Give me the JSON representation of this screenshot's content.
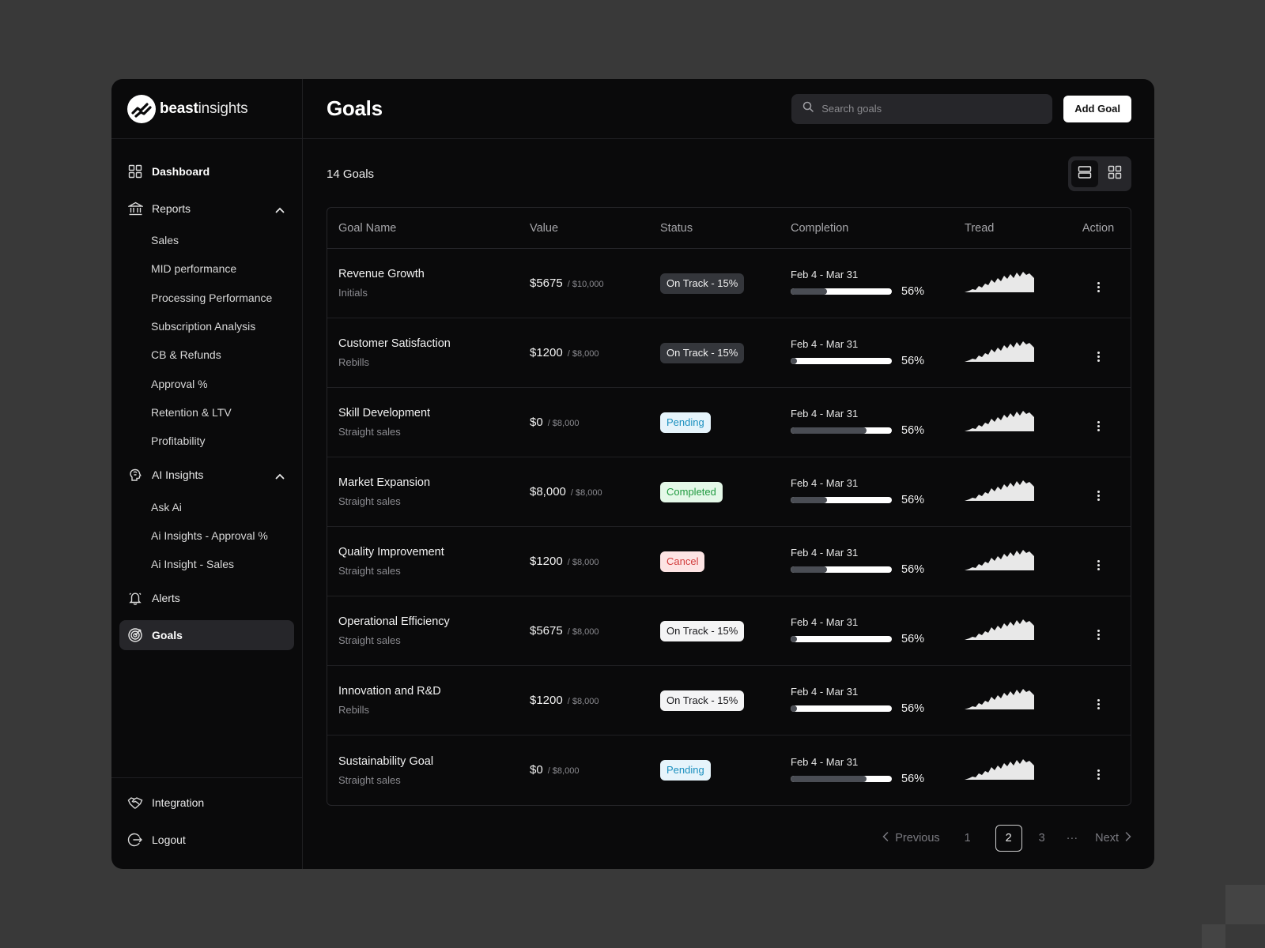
{
  "brand": {
    "name_bold": "beast",
    "name_light": "insights"
  },
  "page": {
    "title": "Goals",
    "count_label": "14 Goals"
  },
  "search": {
    "placeholder": "Search goals"
  },
  "toolbar": {
    "add_label": "Add Goal"
  },
  "sidebar": {
    "dashboard": "Dashboard",
    "reports": {
      "label": "Reports",
      "items": [
        "Sales",
        "MID performance",
        "Processing Performance",
        "Subscription Analysis",
        "CB & Refunds",
        "Approval %",
        "Retention & LTV",
        "Profitability"
      ]
    },
    "ai": {
      "label": "AI Insights",
      "items": [
        "Ask Ai",
        "Ai Insights - Approval %",
        "Ai Insight - Sales"
      ]
    },
    "alerts": "Alerts",
    "goals": "Goals",
    "integration": "Integration",
    "logout": "Logout"
  },
  "table": {
    "headers": [
      "Goal Name",
      "Value",
      "Status",
      "Completion",
      "Tread",
      "Action"
    ],
    "rows": [
      {
        "name": "Revenue Growth",
        "sub": "Initials",
        "value": "$5675",
        "target": "/ $10,000",
        "status": "On Track - 15%",
        "status_style": "dark",
        "date": "Feb 4 - Mar 31",
        "bar_fill": 0.36,
        "pct": "56%"
      },
      {
        "name": "Customer Satisfaction",
        "sub": "Rebills",
        "value": "$1200",
        "target": "/ $8,000",
        "status": "On Track - 15%",
        "status_style": "dark",
        "date": "Feb 4 - Mar 31",
        "bar_fill": 0.06,
        "pct": "56%"
      },
      {
        "name": "Skill Development",
        "sub": "Straight sales",
        "value": "$0",
        "target": "/ $8,000",
        "status": "Pending",
        "status_style": "pending",
        "date": "Feb 4 - Mar 31",
        "bar_fill": 0.75,
        "pct": "56%"
      },
      {
        "name": "Market Expansion",
        "sub": "Straight sales",
        "value": "$8,000",
        "target": "/ $8,000",
        "status": "Completed",
        "status_style": "completed",
        "date": "Feb 4 - Mar 31",
        "bar_fill": 0.36,
        "pct": "56%"
      },
      {
        "name": "Quality Improvement",
        "sub": "Straight sales",
        "value": "$1200",
        "target": "/ $8,000",
        "status": "Cancel",
        "status_style": "cancel",
        "date": "Feb 4 - Mar 31",
        "bar_fill": 0.36,
        "pct": "56%"
      },
      {
        "name": "Operational Efficiency",
        "sub": "Straight sales",
        "value": "$5675",
        "target": "/ $8,000",
        "status": "On Track - 15%",
        "status_style": "light",
        "date": "Feb 4 - Mar 31",
        "bar_fill": 0.06,
        "pct": "56%"
      },
      {
        "name": "Innovation and R&D",
        "sub": "Rebills",
        "value": "$1200",
        "target": "/ $8,000",
        "status": "On Track - 15%",
        "status_style": "light",
        "date": "Feb 4 - Mar 31",
        "bar_fill": 0.06,
        "pct": "56%"
      },
      {
        "name": "Sustainability Goal",
        "sub": "Straight sales",
        "value": "$0",
        "target": "/ $8,000",
        "status": "Pending",
        "status_style": "pending",
        "date": "Feb 4 - Mar 31",
        "bar_fill": 0.75,
        "pct": "56%"
      }
    ]
  },
  "pagination": {
    "previous": "Previous",
    "pages": [
      "1",
      "2",
      "3"
    ],
    "current": "2",
    "ellipsis": "···",
    "next": "Next"
  },
  "colors": {
    "app_bg": "#0a0a0b",
    "page_bg": "#393939",
    "active_nav": "#26262a",
    "bar_track": "#ffffff",
    "bar_fill": "#4a4d54"
  },
  "icons": {
    "dashboard": "grid-icon",
    "reports": "bank-icon",
    "ai": "brain-icon",
    "alerts": "bell-icon",
    "goals": "target-icon",
    "integration": "handshake-icon",
    "logout": "logout-icon"
  }
}
